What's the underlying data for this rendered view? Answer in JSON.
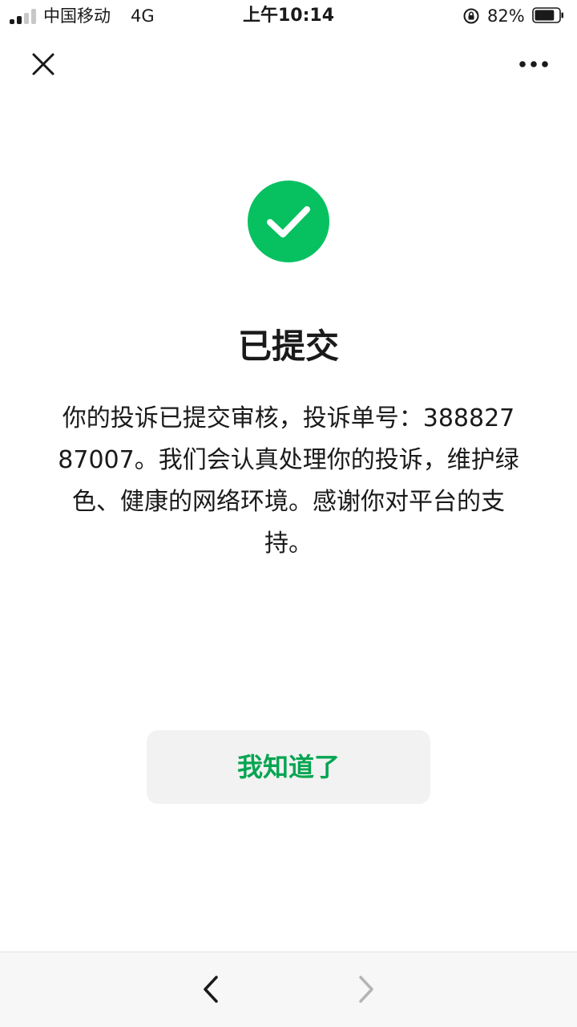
{
  "status_bar": {
    "carrier": "中国移动",
    "network": "4G",
    "time": "上午10:14",
    "battery_percent": "82%",
    "battery_level": 0.82
  },
  "nav": {
    "close_icon": "close-icon",
    "more_icon": "more-dots-icon"
  },
  "result": {
    "icon": "check-circle-icon",
    "icon_color": "#07c160",
    "title": "已提交",
    "description": "你的投诉已提交审核，投诉单号：38882787007。我们会认真处理你的投诉，维护绿色、健康的网络环境。感谢你对平台的支持。"
  },
  "actions": {
    "confirm_label": "我知道了",
    "confirm_color": "#07a552"
  },
  "toolbar": {
    "back_icon": "chevron-left-icon",
    "forward_icon": "chevron-right-icon"
  }
}
